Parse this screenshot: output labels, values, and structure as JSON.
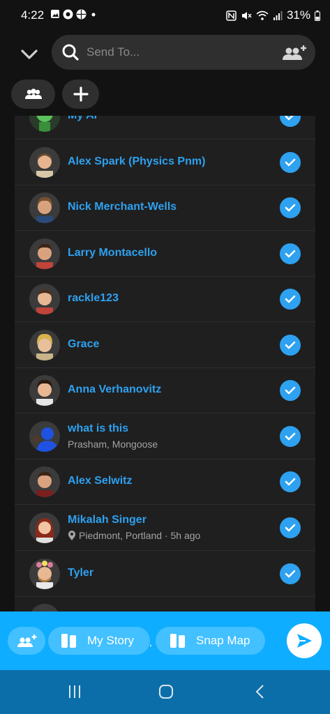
{
  "status": {
    "time": "4:22",
    "battery": "31%"
  },
  "search": {
    "placeholder": "Send To..."
  },
  "contacts": [
    {
      "name": "My AI",
      "sub": "",
      "checked": true
    },
    {
      "name": "Alex Spark (Physics Pnm)",
      "sub": "",
      "checked": true
    },
    {
      "name": "Nick Merchant-Wells",
      "sub": "",
      "checked": true
    },
    {
      "name": "Larry Montacello",
      "sub": "",
      "checked": true
    },
    {
      "name": "rackle123",
      "sub": "",
      "checked": true
    },
    {
      "name": "Grace",
      "sub": "",
      "checked": true
    },
    {
      "name": "Anna Verhanovitz",
      "sub": "",
      "checked": true
    },
    {
      "name": "what is this",
      "sub": "Prasham, Mongoose",
      "checked": true
    },
    {
      "name": "Alex Selwitz",
      "sub": "",
      "checked": true
    },
    {
      "name": "Mikalah Singer",
      "sub": "Piedmont, Portland · 5h ago",
      "checked": true
    },
    {
      "name": "Tyler",
      "sub": "",
      "checked": true
    }
  ],
  "bottom": {
    "my_story": "My Story",
    "snap_map": "Snap Map",
    "separator": ","
  },
  "colors": {
    "accent": "#2ea1f0",
    "send_bar": "#0fadff",
    "nav_bar": "#0c6ea8"
  }
}
